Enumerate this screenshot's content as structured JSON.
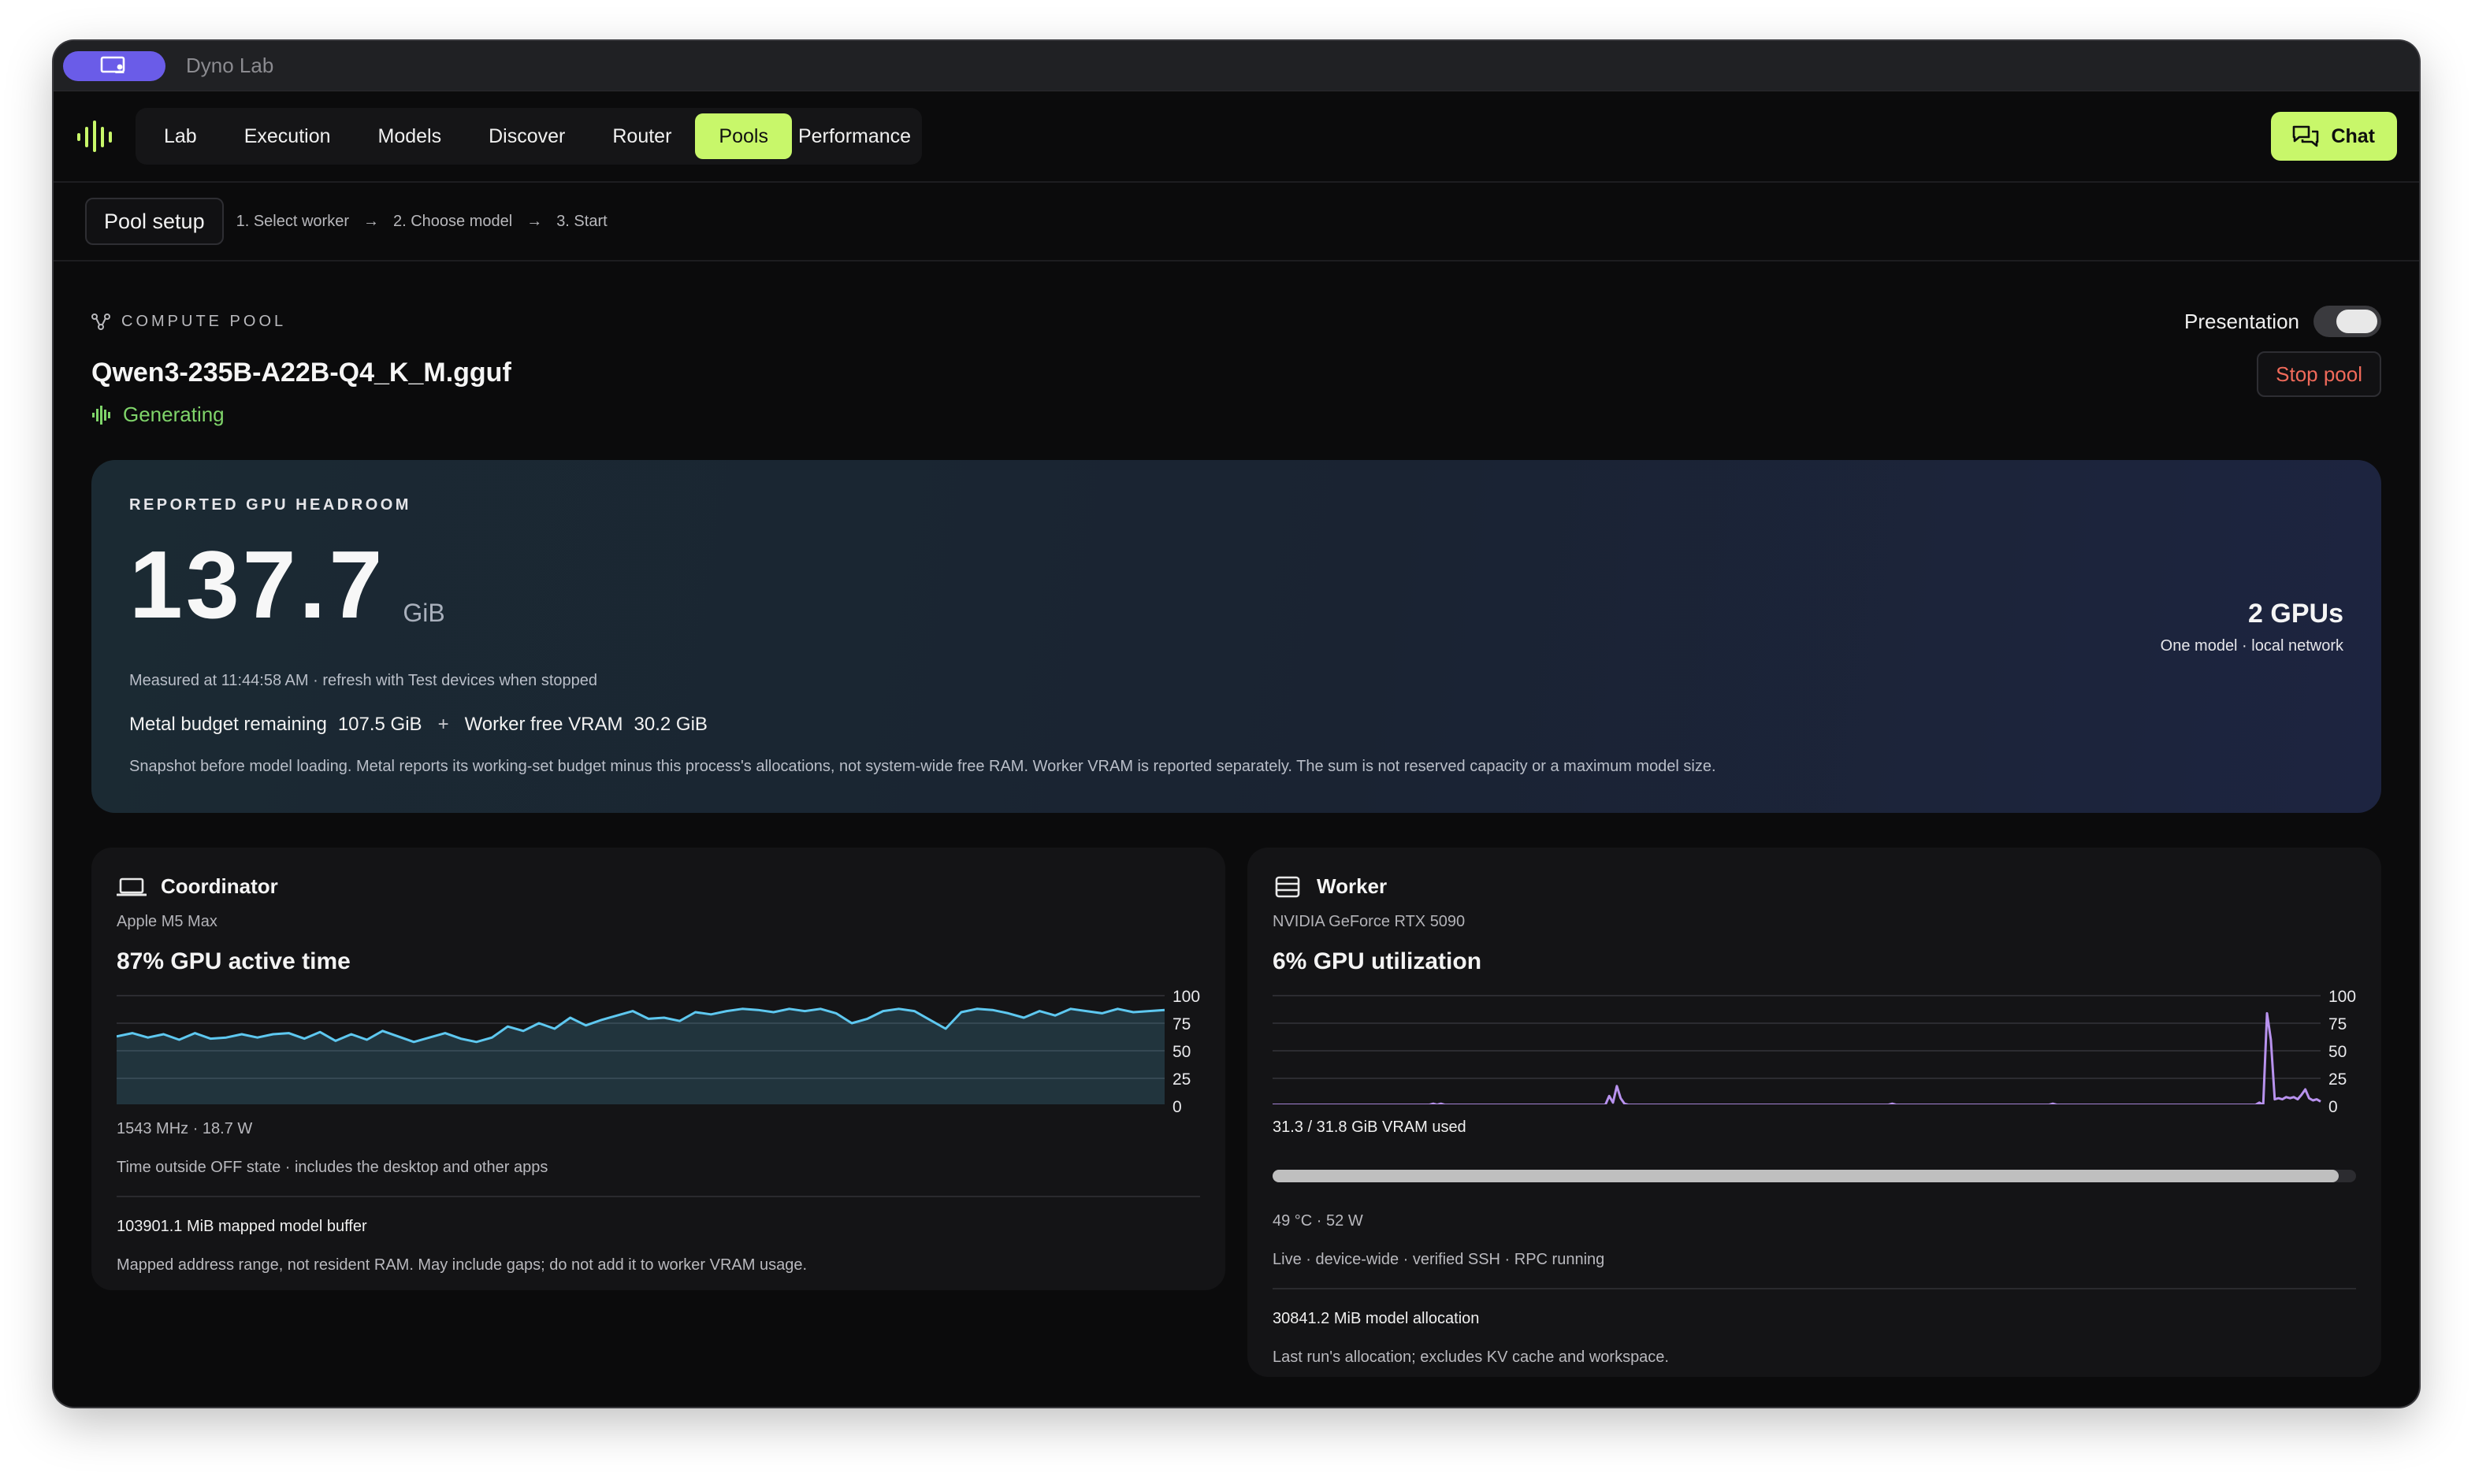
{
  "app": {
    "title": "Dyno Lab"
  },
  "nav": {
    "tabs": [
      {
        "label": "Lab",
        "active": false
      },
      {
        "label": "Execution",
        "active": false
      },
      {
        "label": "Models",
        "active": false
      },
      {
        "label": "Discover",
        "active": false
      },
      {
        "label": "Router",
        "active": false
      },
      {
        "label": "Pools",
        "active": true
      },
      {
        "label": "Performance",
        "active": false
      }
    ],
    "chat_label": "Chat"
  },
  "setup": {
    "button_label": "Pool setup",
    "steps": [
      "1. Select worker",
      "2. Choose model",
      "3. Start"
    ]
  },
  "pool": {
    "section_label": "COMPUTE POOL",
    "presentation_label": "Presentation",
    "presentation_on": true,
    "model_name": "Qwen3-235B-A22B-Q4_K_M.gguf",
    "status": "Generating",
    "stop_label": "Stop pool"
  },
  "headroom": {
    "label": "REPORTED GPU HEADROOM",
    "value": "137.7",
    "unit": "GiB",
    "gpus": "2 GPUs",
    "gpus_sub": "One model · local network",
    "measured": "Measured at 11:44:58 AM · refresh with Test devices when stopped",
    "metal_label": "Metal budget remaining",
    "metal_value": "107.5 GiB",
    "plus": "+",
    "worker_label": "Worker free VRAM",
    "worker_value": "30.2 GiB",
    "note": "Snapshot before model loading. Metal reports its working-set budget minus this process's allocations, not system-wide free RAM. Worker VRAM is reported separately. The sum is not reserved capacity or a maximum model size."
  },
  "coordinator": {
    "title": "Coordinator",
    "device": "Apple M5 Max",
    "metric": "87% GPU active time",
    "freq_power": "1543 MHz  ·  18.7 W",
    "state_note": "Time outside OFF state · includes the desktop and other apps",
    "buffer": "103901.1 MiB mapped model buffer",
    "buffer_note": "Mapped address range, not resident RAM. May include gaps; do not add it to worker VRAM usage."
  },
  "worker": {
    "title": "Worker",
    "device": "NVIDIA GeForce RTX 5090",
    "metric": "6% GPU utilization",
    "vram": "31.3 / 31.8 GiB VRAM used",
    "vram_fraction": 0.984,
    "temp_power": "49 °C · 52 W",
    "status_line": "Live · device-wide · verified SSH · RPC running",
    "allocation": "30841.2 MiB model allocation",
    "allocation_note": "Last run's allocation; excludes KV cache and workspace."
  },
  "colors": {
    "accent": "#c8f76a",
    "coord_line": "#5ec8f0",
    "worker_line": "#b892ee",
    "generating": "#7fd46a",
    "stop": "#f06a5a"
  },
  "chart_data": [
    {
      "type": "area",
      "y_ticks": [
        "100",
        "75",
        "50",
        "25",
        "0"
      ],
      "ylim": [
        0,
        100
      ],
      "series": [
        {
          "values": [
            63,
            66,
            62,
            65,
            60,
            66,
            61,
            62,
            65,
            62,
            65,
            66,
            61,
            67,
            59,
            65,
            60,
            68,
            63,
            58,
            62,
            66,
            61,
            58,
            62,
            72,
            68,
            75,
            70,
            80,
            73,
            78,
            82,
            86,
            79,
            80,
            77,
            85,
            83,
            86,
            88,
            87,
            85,
            88,
            86,
            88,
            84,
            75,
            79,
            86,
            88,
            86,
            78,
            70,
            85,
            88,
            87,
            84,
            80,
            86,
            82,
            88,
            86,
            84,
            88,
            85,
            86,
            87
          ]
        }
      ]
    },
    {
      "type": "line",
      "y_ticks": [
        "100",
        "75",
        "50",
        "25",
        "0"
      ],
      "ylim": [
        0,
        100
      ],
      "series": [
        {
          "values": [
            1,
            1,
            1,
            1,
            1,
            1,
            1,
            1,
            1,
            1,
            1,
            1,
            1,
            1,
            1,
            1,
            1,
            1,
            1,
            1,
            1,
            1,
            1,
            1,
            1,
            1,
            1,
            1,
            1,
            1,
            1,
            1,
            1,
            1,
            1,
            1,
            1,
            1,
            1,
            1,
            1,
            1,
            2,
            1,
            2,
            1,
            1,
            1,
            1,
            1,
            1,
            1,
            1,
            1,
            1,
            1,
            1,
            1,
            1,
            1,
            1,
            1,
            1,
            1,
            1,
            1,
            1,
            1,
            1,
            1,
            1,
            1,
            1,
            1,
            1,
            1,
            1,
            1,
            1,
            1,
            1,
            1,
            1,
            1,
            1,
            1,
            1,
            1,
            9,
            3,
            18,
            7,
            2,
            1,
            1,
            1,
            1,
            1,
            1,
            1,
            1,
            1,
            1,
            1,
            1,
            1,
            1,
            1,
            1,
            1,
            1,
            1,
            1,
            1,
            1,
            1,
            1,
            1,
            1,
            1,
            1,
            1,
            1,
            1,
            1,
            1,
            1,
            1,
            1,
            1,
            1,
            1,
            1,
            1,
            1,
            1,
            1,
            1,
            1,
            1,
            1,
            1,
            1,
            1,
            1,
            1,
            1,
            1,
            1,
            1,
            1,
            1,
            1,
            1,
            1,
            1,
            1,
            1,
            1,
            1,
            1,
            1,
            2,
            1,
            1,
            1,
            1,
            1,
            1,
            1,
            1,
            1,
            1,
            1,
            1,
            1,
            1,
            1,
            1,
            1,
            1,
            1,
            1,
            1,
            1,
            1,
            1,
            1,
            1,
            1,
            1,
            1,
            1,
            1,
            1,
            1,
            1,
            1,
            1,
            1,
            1,
            1,
            1,
            1,
            2,
            1,
            1,
            1,
            1,
            1,
            1,
            1,
            1,
            1,
            1,
            1,
            1,
            1,
            1,
            1,
            1,
            1,
            1,
            1,
            1,
            1,
            1,
            1,
            1,
            1,
            1,
            1,
            1,
            1,
            1,
            1,
            1,
            1,
            1,
            1,
            1,
            1,
            1,
            1,
            1,
            1,
            1,
            1,
            1,
            1,
            1,
            1,
            1,
            1,
            1,
            1,
            1,
            1,
            3,
            1,
            84,
            60,
            6,
            7,
            6,
            8,
            7,
            8,
            6,
            10,
            15,
            7,
            5,
            6,
            4
          ]
        }
      ]
    }
  ]
}
